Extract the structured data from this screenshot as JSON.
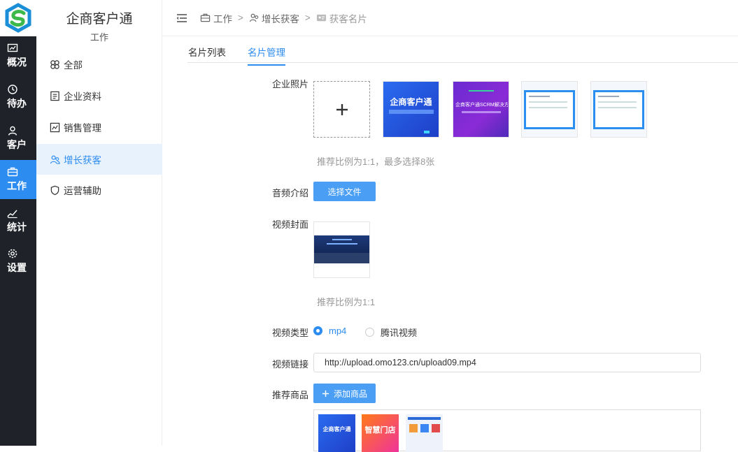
{
  "app": {
    "title": "企商客户通",
    "subtitle": "工作"
  },
  "rail": [
    {
      "label": "概况",
      "icon": "chart-window-icon",
      "active": false
    },
    {
      "label": "待办",
      "icon": "clock-icon",
      "active": false
    },
    {
      "label": "客户",
      "icon": "person-icon",
      "active": false
    },
    {
      "label": "工作",
      "icon": "briefcase-icon",
      "active": true
    },
    {
      "label": "统计",
      "icon": "line-chart-icon",
      "active": false
    },
    {
      "label": "设置",
      "icon": "gear-icon",
      "active": false
    }
  ],
  "sidebar": {
    "items": [
      {
        "label": "全部",
        "icon": "clover-icon"
      },
      {
        "label": "企业资料",
        "icon": "document-icon"
      },
      {
        "label": "销售管理",
        "icon": "bar-chart-icon"
      },
      {
        "label": "增长获客",
        "icon": "users-icon"
      },
      {
        "label": "运营辅助",
        "icon": "shield-icon"
      }
    ]
  },
  "breadcrumb": {
    "first": "工作",
    "second": "增长获客",
    "third": "获客名片"
  },
  "tabs": {
    "list": "名片列表",
    "manage": "名片管理"
  },
  "form": {
    "photos_label": "企业照片",
    "photos_hint": "推荐比例为1:1，最多选择8张",
    "thumb1_title": "企商客户通",
    "thumb2_title": "企商客户通SCRM解决方案",
    "audio_label": "音频介绍",
    "audio_button": "选择文件",
    "video_cover_label": "视频封面",
    "video_cover_hint": "推荐比例为1:1",
    "video_type_label": "视频类型",
    "video_type_mp4": "mp4",
    "video_type_tencent": "腾讯视频",
    "video_link_label": "视频链接",
    "video_link_value": "http://upload.omo123.cn/upload09.mp4",
    "goods_label": "推荐商品",
    "goods_button": "添加商品",
    "goods_thumb1_title": "企商客户通",
    "goods_thumb2_title": "智慧门店"
  },
  "colors": {
    "accent": "#2d8cf0",
    "rail_bg": "#1f2329",
    "button": "#4a9ff5"
  }
}
